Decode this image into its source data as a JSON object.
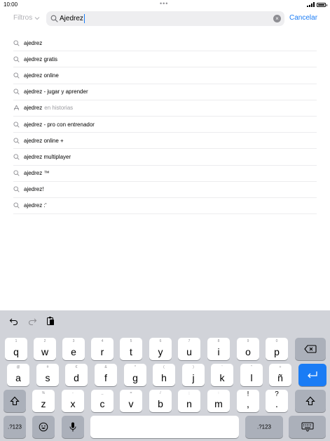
{
  "status": {
    "time": "10:00",
    "center_dots": "•••"
  },
  "search": {
    "filters_label": "Filtros",
    "query": "Ajedrez",
    "cancel_label": "Cancelar"
  },
  "suggestions": [
    {
      "text": "ajedrez",
      "suffix": "",
      "icon": "search-icon"
    },
    {
      "text": "ajedrez gratis",
      "suffix": "",
      "icon": "search-icon"
    },
    {
      "text": "ajedrez online",
      "suffix": "",
      "icon": "search-icon"
    },
    {
      "text": "ajedrez - jugar y aprender",
      "suffix": "",
      "icon": "search-icon"
    },
    {
      "text": "ajedrez",
      "suffix": "en historias",
      "icon": "stories-icon"
    },
    {
      "text": "ajedrez - pro con entrenador",
      "suffix": "",
      "icon": "search-icon"
    },
    {
      "text": "ajedrez online +",
      "suffix": "",
      "icon": "search-icon"
    },
    {
      "text": "ajedrez multiplayer",
      "suffix": "",
      "icon": "search-icon"
    },
    {
      "text": "ajedrez ™",
      "suffix": "",
      "icon": "search-icon"
    },
    {
      "text": "ajedrez!",
      "suffix": "",
      "icon": "search-icon"
    },
    {
      "text": "ajedrez :'",
      "suffix": "",
      "icon": "search-icon"
    }
  ],
  "keyboard": {
    "row1": [
      {
        "alt": "1",
        "main": "q"
      },
      {
        "alt": "2",
        "main": "w"
      },
      {
        "alt": "3",
        "main": "e"
      },
      {
        "alt": "4",
        "main": "r"
      },
      {
        "alt": "5",
        "main": "t"
      },
      {
        "alt": "6",
        "main": "y"
      },
      {
        "alt": "7",
        "main": "u"
      },
      {
        "alt": "8",
        "main": "i"
      },
      {
        "alt": "9",
        "main": "o"
      },
      {
        "alt": "0",
        "main": "p"
      }
    ],
    "row2": [
      {
        "alt": "@",
        "main": "a"
      },
      {
        "alt": "#",
        "main": "s"
      },
      {
        "alt": "€",
        "main": "d"
      },
      {
        "alt": "&",
        "main": "f"
      },
      {
        "alt": "*",
        "main": "g"
      },
      {
        "alt": "(",
        "main": "h"
      },
      {
        "alt": ")",
        "main": "j"
      },
      {
        "alt": "'",
        "main": "k"
      },
      {
        "alt": "\"",
        "main": "l"
      },
      {
        "alt": "+",
        "main": "ñ"
      }
    ],
    "row3": [
      {
        "alt": "%",
        "main": "z"
      },
      {
        "alt": "-",
        "main": "x"
      },
      {
        "alt": "_",
        "main": "c"
      },
      {
        "alt": "=",
        "main": "v"
      },
      {
        "alt": "/",
        "main": "b"
      },
      {
        "alt": ";",
        "main": "n"
      },
      {
        "alt": ":",
        "main": "m"
      },
      {
        "alt": "!",
        "main": ","
      },
      {
        "alt": "?",
        "main": "."
      }
    ],
    "numbers_label": ".?123",
    "numbers_label_right": ".?123"
  },
  "colors": {
    "accent": "#1a7cf5",
    "keyboard_bg": "#d1d3d9",
    "dark_key": "#abb0ba"
  }
}
